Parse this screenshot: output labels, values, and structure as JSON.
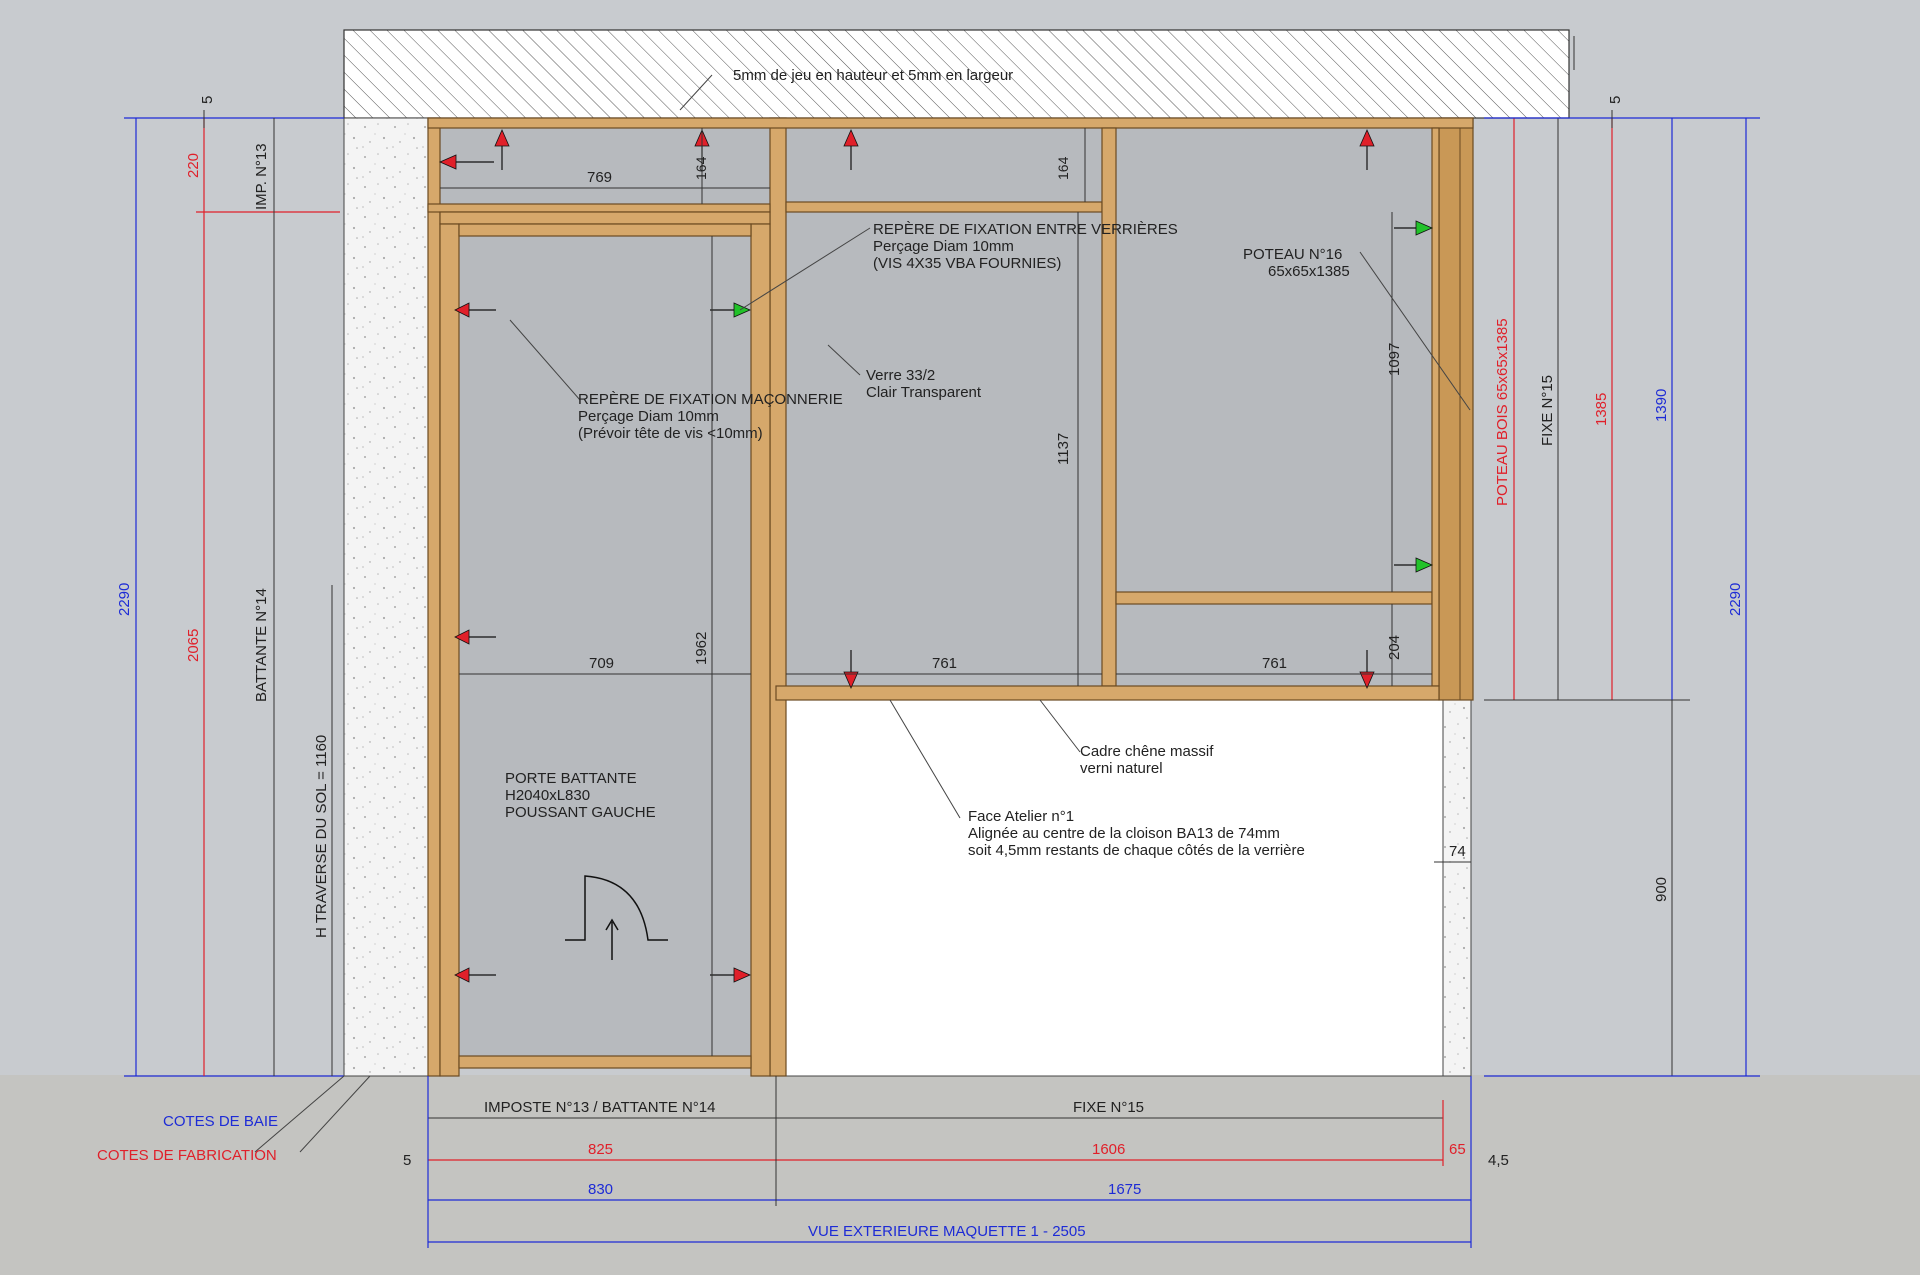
{
  "title": "VUE EXTERIEURE MAQUETTE 1 - 2505",
  "legend": {
    "cotes_de_baie": "COTES DE BAIE",
    "cotes_de_fabrication": "COTES DE FABRICATION"
  },
  "notes": {
    "jeu": "5mm de jeu en hauteur et 5mm en largeur",
    "fixation_verrieres": [
      "REPÈRE DE FIXATION ENTRE VERRIÈRES",
      "Perçage Diam 10mm",
      "(VIS 4X35 VBA FOURNIES)"
    ],
    "fixation_maconnerie": [
      "REPÈRE DE FIXATION MAÇONNERIE",
      "Perçage Diam 10mm",
      "(Prévoir tête de vis <10mm)"
    ],
    "verre": [
      "Verre 33/2",
      "Clair Transparent"
    ],
    "poteau16": [
      "POTEAU N°16",
      "65x65x1385"
    ],
    "cadre": [
      "Cadre chêne massif",
      "verni naturel"
    ],
    "face_atelier": [
      "Face Atelier n°1",
      "Alignée au centre de la cloison BA13 de 74mm",
      "soit 4,5mm restants de chaque côtés de la verrière"
    ],
    "porte": [
      "PORTE BATTANTE",
      "H2040xL830",
      "POUSSANT GAUCHE"
    ]
  },
  "labels": {
    "imp13": "IMP. N°13",
    "battante14": "BATTANTE N°14",
    "traverse_sol": "H TRAVERSE DU SOL = 1160",
    "fixe15_v": "FIXE N°15",
    "poteau_bois": "POTEAU BOIS 65x65x1385",
    "imposte_battante": "IMPOSTE N°13 / BATTANTE N°14",
    "fixe15_h": "FIXE N°15"
  },
  "dimensions": {
    "top_left_5": "5",
    "top_right_5": "5",
    "d220": "220",
    "d2065": "2065",
    "d2290_left": "2290",
    "d2290_right": "2290",
    "d1390": "1390",
    "d1385": "1385",
    "d900": "900",
    "d769": "769",
    "d164a": "164",
    "d164b": "164",
    "d709": "709",
    "d1962": "1962",
    "d1137": "1137",
    "d1097": "1097",
    "d204": "204",
    "d761a": "761",
    "d761b": "761",
    "d74": "74",
    "d5_bottom": "5",
    "d825": "825",
    "d1606": "1606",
    "d65": "65",
    "d4_5": "4,5",
    "d830": "830",
    "d1675": "1675"
  },
  "colors": {
    "blue": "#1d2bd6",
    "red": "#e0202a",
    "wood": "#d6a86b",
    "glass": "#b7babe",
    "arrow_red": "#e0202a",
    "arrow_green": "#22c22a"
  }
}
